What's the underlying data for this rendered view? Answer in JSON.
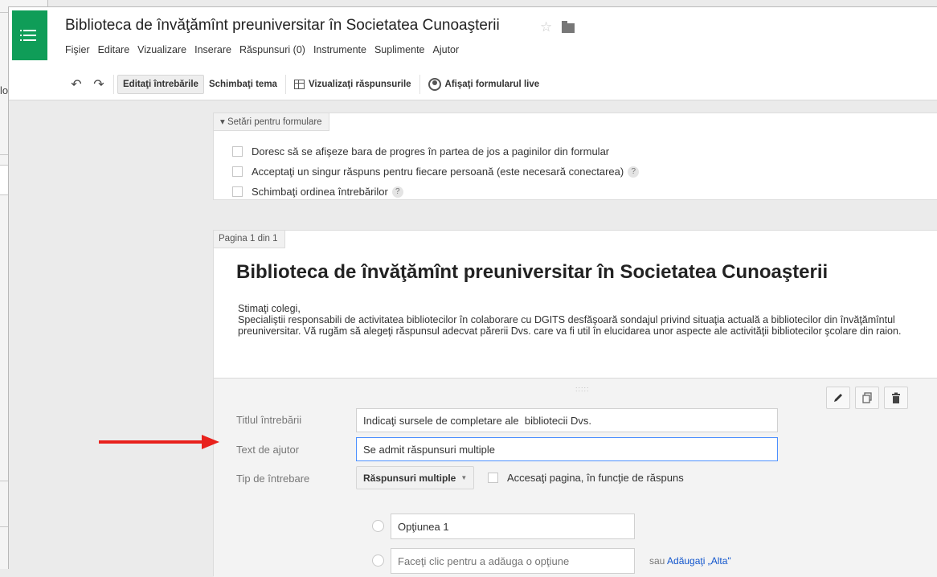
{
  "background": {
    "fragment_text": "lo"
  },
  "header": {
    "title": "Biblioteca de învăţămînt preuniversitar în Societatea Cunoaşterii",
    "star_icon": "☆",
    "menu": [
      "Fişier",
      "Editare",
      "Vizualizare",
      "Inserare",
      "Răspunsuri (0)",
      "Instrumente",
      "Suplimente",
      "Ajutor"
    ]
  },
  "toolbar": {
    "undo_icon": "↶",
    "redo_icon": "↷",
    "edit_questions": "Editaţi întrebările",
    "change_theme": "Schimbaţi tema",
    "view_responses": "Vizualizaţi răspunsurile",
    "view_live_form": "Afişaţi formularul live"
  },
  "settings": {
    "tab_label": "▾ Setări pentru formulare",
    "options": [
      "Doresc să se afişeze bara de progres în partea de jos a paginilor din formular",
      "Acceptaţi un singur răspuns pentru fiecare persoană (este necesară conectarea)",
      "Schimbaţi ordinea întrebărilor"
    ],
    "help_glyph": "?"
  },
  "page": {
    "tab_label": "Pagina 1 din 1",
    "form_title": "Biblioteca de învăţămînt preuniversitar în Societatea Cunoaşterii",
    "description_lines": [
      "Stimaţi colegi,",
      "Specialiştii responsabili de activitatea bibliotecilor în colaborare cu DGITS desfăşoară  sondajul privind situaţia actuală a bibliotecilor din învăţămîntul preuniversitar. Vă rugăm să alegeţi răspunsul adecvat părerii Dvs. care va fi util în elucidarea unor aspecte ale activităţii bibliotecilor  şcolare din raion."
    ]
  },
  "question": {
    "drag_glyph": ":::::",
    "title_label": "Titlul întrebării",
    "title_value": "Indicaţi sursele de completare ale  bibliotecii Dvs.",
    "help_label": "Text de ajutor",
    "help_value": "Se admit răspunsuri multiple",
    "type_label": "Tip de întrebare",
    "type_value": "Răspunsuri multiple",
    "nav_checkbox_label": "Accesaţi pagina, în funcţie de răspuns",
    "option_1": "Opţiunea 1",
    "add_option_placeholder": "Faceţi clic pentru a adăuga o opţiune",
    "or_text": "sau",
    "add_other_link": "Adăugaţi „Alta\""
  },
  "colors": {
    "brand_green": "#0f9d58",
    "link_blue": "#1155cc",
    "focus_blue": "#4d90fe",
    "annotation_red": "#e8211c"
  }
}
